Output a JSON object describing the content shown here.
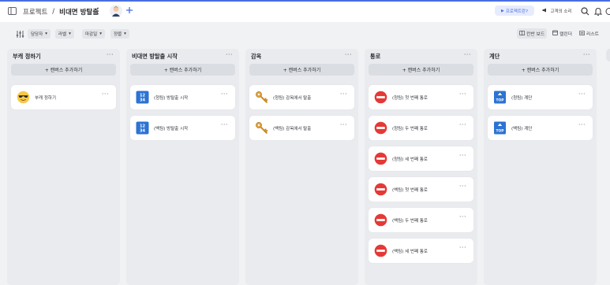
{
  "header": {
    "sidebar_icon": "sidebar-panel-icon",
    "breadcrumb_project": "프로젝트",
    "separator": "/",
    "breadcrumb_board": "비대면 방탈출",
    "more_icon": "vertical-ellipsis-icon",
    "avatar_icon": "user-avatar",
    "add_icon": "plus-icon",
    "project_button_label": "프로젝트란?",
    "customer_voice_label": "고객의 소리",
    "search_icon": "search-icon",
    "bell_icon": "bell-icon",
    "accent_color": "#4a6ee0"
  },
  "toolbar": {
    "filters": [
      {
        "label": "담당자"
      },
      {
        "label": "라벨"
      },
      {
        "label": "마감일"
      },
      {
        "label": "정렬"
      }
    ],
    "views": [
      {
        "label": "칸반 보드",
        "icon": "kanban-icon",
        "active": true
      },
      {
        "label": "캘린더",
        "icon": "calendar-icon",
        "active": false
      },
      {
        "label": "리스트",
        "icon": "list-icon",
        "active": false
      }
    ]
  },
  "board": {
    "add_card_label": "+ 캔버스 추가하기",
    "columns": [
      {
        "title": "부캐 정하기",
        "cards": [
          {
            "label": "부캐 정하기",
            "icon": "sunglasses-emoji-icon"
          }
        ]
      },
      {
        "title": "비대면 방탈출 시작",
        "cards": [
          {
            "label": "(청팀) 방탈출 시작",
            "icon": "numbers-1234-icon"
          },
          {
            "label": "(백팀) 방탈출 시작",
            "icon": "numbers-1234-icon"
          }
        ]
      },
      {
        "title": "감옥",
        "cards": [
          {
            "label": "(청팀) 감옥에서 탈출",
            "icon": "key-icon"
          },
          {
            "label": "(백팀) 감옥에서 탈출",
            "icon": "key-icon"
          }
        ]
      },
      {
        "title": "통로",
        "cards": [
          {
            "label": "(청팀) 첫 번째 통로",
            "icon": "no-entry-icon"
          },
          {
            "label": "(청팀) 두 번째 통로",
            "icon": "no-entry-icon"
          },
          {
            "label": "(청팀) 세 번째 통로",
            "icon": "no-entry-icon"
          },
          {
            "label": "(백팀) 첫 번째 통로",
            "icon": "no-entry-icon"
          },
          {
            "label": "(백팀) 두 번째 통로",
            "icon": "no-entry-icon"
          },
          {
            "label": "(백팀) 세 번째 통로",
            "icon": "no-entry-icon"
          }
        ]
      },
      {
        "title": "계단",
        "cards": [
          {
            "label": "(청팀) 계단",
            "icon": "top-arrow-icon"
          },
          {
            "label": "(백팀) 계단",
            "icon": "top-arrow-icon"
          }
        ]
      }
    ]
  }
}
